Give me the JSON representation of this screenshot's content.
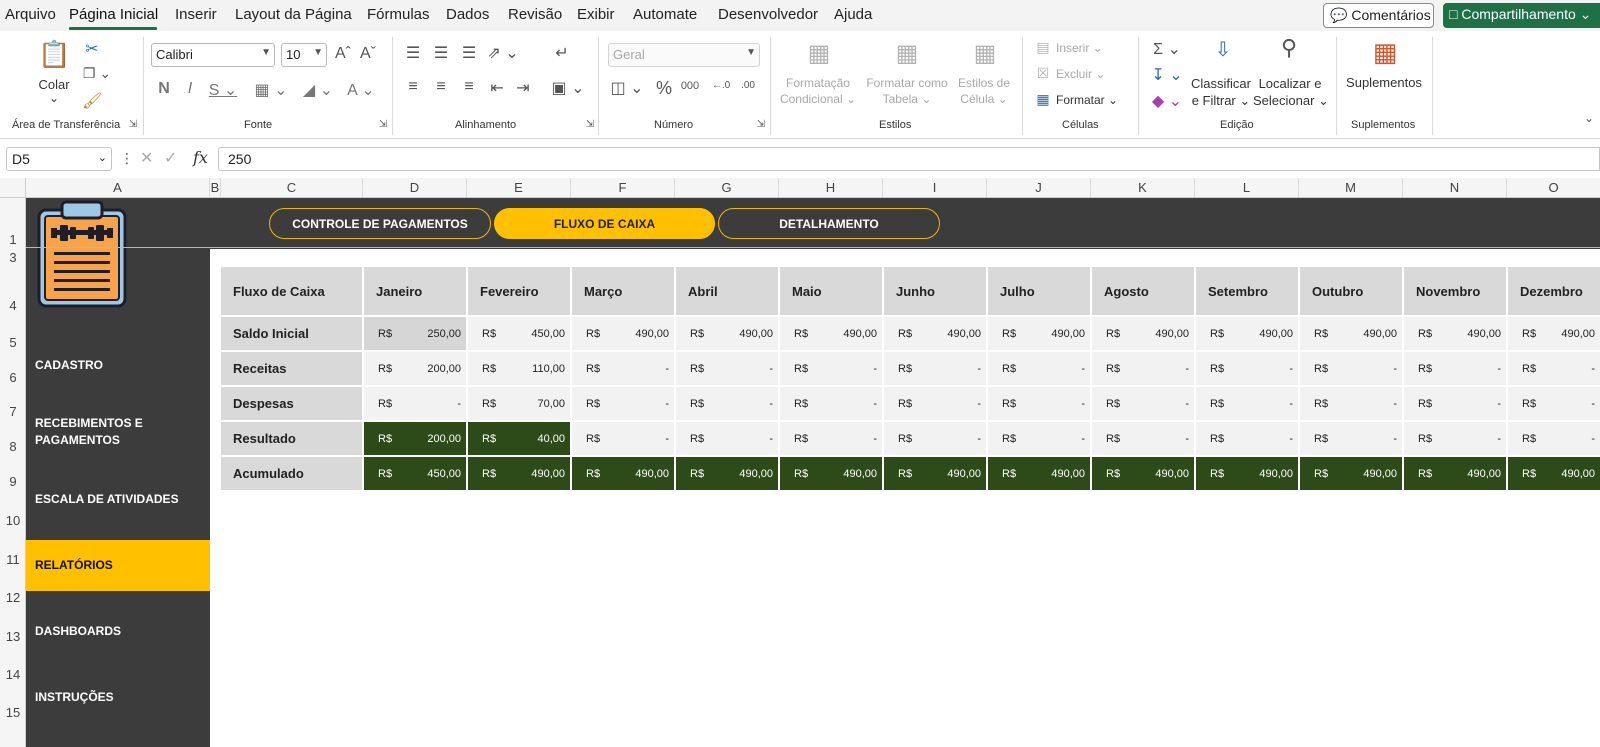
{
  "menu": {
    "items": [
      "Arquivo",
      "Página Inicial",
      "Inserir",
      "Layout da Página",
      "Fórmulas",
      "Dados",
      "Revisão",
      "Exibir",
      "Automate",
      "Desenvolvedor",
      "Ajuda"
    ],
    "comments_label": "Comentários",
    "share_label": "Compartilhamento"
  },
  "ribbon": {
    "clipboard": {
      "paste_label": "Colar",
      "group_label": "Área de Transferência"
    },
    "font": {
      "name": "Calibri",
      "size": "10",
      "group_label": "Fonte"
    },
    "alignment": {
      "group_label": "Alinhamento"
    },
    "number": {
      "format": "Geral",
      "group_label": "Número"
    },
    "styles": {
      "conditional": [
        "Formatação",
        "Condicional"
      ],
      "as_table": [
        "Formatar como",
        "Tabela"
      ],
      "cell_styles": [
        "Estilos de",
        "Célula"
      ],
      "group_label": "Estilos"
    },
    "cells": {
      "insert": "Inserir",
      "delete": "Excluir",
      "format": "Formatar",
      "group_label": "Células"
    },
    "editing": {
      "sort": [
        "Classificar",
        "e Filtrar"
      ],
      "find": [
        "Localizar e",
        "Selecionar"
      ],
      "group_label": "Edição"
    },
    "addins": {
      "label": "Suplementos",
      "group_label": "Suplementos"
    }
  },
  "formula_bar": {
    "name_box": "D5",
    "fx": "fx",
    "value": "250"
  },
  "columns": [
    "A",
    "B",
    "C",
    "D",
    "E",
    "F",
    "G",
    "H",
    "I",
    "J",
    "K",
    "L",
    "M",
    "N",
    "O"
  ],
  "rows": [
    "1",
    "3",
    "4",
    "5",
    "6",
    "7",
    "8",
    "9",
    "10",
    "11",
    "12",
    "13",
    "14",
    "15"
  ],
  "nav_tabs": [
    "CONTROLE DE PAGAMENTOS",
    "FLUXO DE CAIXA",
    "DETALHAMENTO"
  ],
  "sidebar": [
    "CADASTRO",
    "RECEBIMENTOS E PAGAMENTOS",
    "ESCALA DE ATIVIDADES",
    "RELATÓRIOS",
    "DASHBOARDS",
    "INSTRUÇÕES"
  ],
  "colors": {
    "accent": "#ffc000",
    "dark": "#3c3c3c",
    "green": "#2c4b18",
    "excel_green": "#1e7145"
  },
  "table": {
    "corner": "Fluxo de Caixa",
    "months": [
      "Janeiro",
      "Fevereiro",
      "Março",
      "Abril",
      "Maio",
      "Junho",
      "Julho",
      "Agosto",
      "Setembro",
      "Outubro",
      "Novembro",
      "Dezembro"
    ],
    "currency": "R$",
    "rows": [
      {
        "label": "Saldo Inicial",
        "values": [
          "250,00",
          "450,00",
          "490,00",
          "490,00",
          "490,00",
          "490,00",
          "490,00",
          "490,00",
          "490,00",
          "490,00",
          "490,00",
          "490,00"
        ]
      },
      {
        "label": "Receitas",
        "values": [
          "200,00",
          "110,00",
          "-",
          "-",
          "-",
          "-",
          "-",
          "-",
          "-",
          "-",
          "-",
          "-"
        ]
      },
      {
        "label": "Despesas",
        "values": [
          "-",
          "70,00",
          "-",
          "-",
          "-",
          "-",
          "-",
          "-",
          "-",
          "-",
          "-",
          "-"
        ]
      },
      {
        "label": "Resultado",
        "values": [
          "200,00",
          "40,00",
          "-",
          "-",
          "-",
          "-",
          "-",
          "-",
          "-",
          "-",
          "-",
          "-"
        ]
      },
      {
        "label": "Acumulado",
        "values": [
          "450,00",
          "490,00",
          "490,00",
          "490,00",
          "490,00",
          "490,00",
          "490,00",
          "490,00",
          "490,00",
          "490,00",
          "490,00",
          "490,00"
        ]
      }
    ]
  }
}
